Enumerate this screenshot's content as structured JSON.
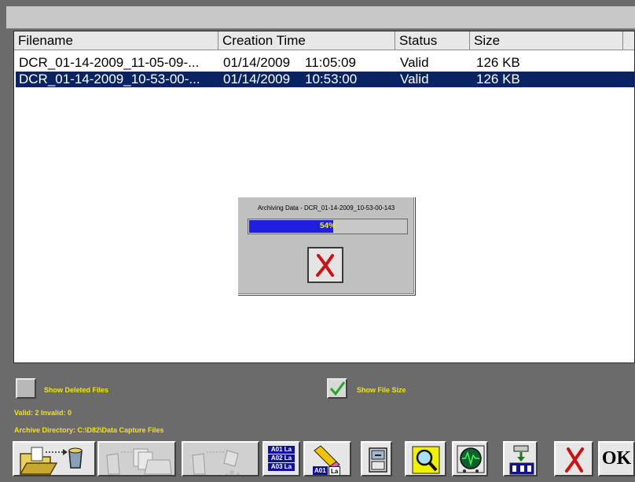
{
  "file_list": {
    "columns": [
      "Filename",
      "Creation Time",
      "Status",
      "Size"
    ],
    "rows": [
      {
        "filename": "DCR_01-14-2009_11-05-09-...",
        "date": "01/14/2009",
        "time": "11:05:09",
        "status": "Valid",
        "size": "126 KB",
        "selected": false
      },
      {
        "filename": "DCR_01-14-2009_10-53-00-...",
        "date": "01/14/2009",
        "time": "10:53:00",
        "status": "Valid",
        "size": "126 KB",
        "selected": true
      }
    ]
  },
  "progress_dialog": {
    "title": "Archiving Data - DCR_01-14-2009_10-53-00-143",
    "progress_text": "54%",
    "progress_fraction": 0.54
  },
  "options": {
    "show_deleted_label": "Show Deleted Files",
    "show_deleted_checked": false,
    "show_size_label": "Show File Size",
    "show_size_checked": true
  },
  "status": {
    "counts": "Valid: 2  Invalid: 0",
    "archive_dir": "Archive Directory: C:\\D82\\Data Capture Files"
  },
  "toolbar": {
    "tag1": "A01 La",
    "tag2": "A02 La",
    "tag3": "A03 La",
    "tag4": "A01",
    "tag5": "La",
    "ok_label": "OK"
  },
  "colors": {
    "selection": "#0a2463",
    "progress_fill": "#1f1fe0",
    "label_yellow": "#f2e600",
    "cancel_red": "#d01010",
    "check_green": "#22aa22"
  }
}
